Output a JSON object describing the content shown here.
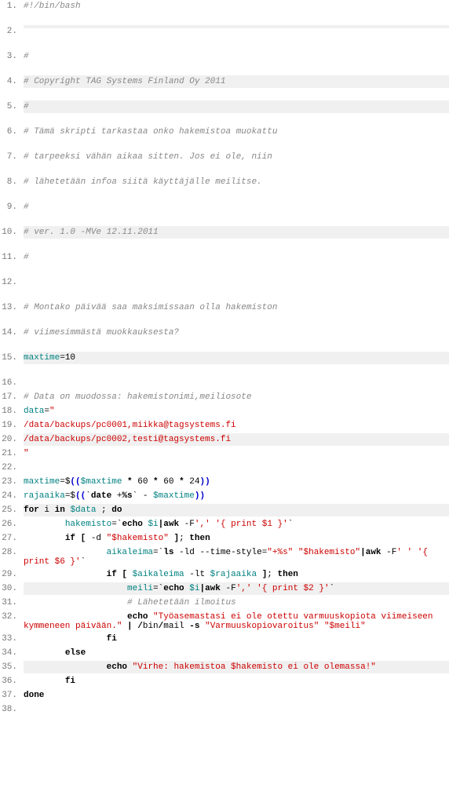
{
  "lines": [
    {
      "n": "1.",
      "tall": true,
      "hl": false,
      "spans": [
        {
          "t": "#!/bin/bash",
          "cls": "c-comment"
        }
      ]
    },
    {
      "n": "2.",
      "tall": true,
      "hl": true,
      "spans": []
    },
    {
      "n": "3.",
      "tall": true,
      "hl": false,
      "spans": [
        {
          "t": "#",
          "cls": "c-comment"
        }
      ]
    },
    {
      "n": "4.",
      "tall": true,
      "hl": true,
      "spans": [
        {
          "t": "# Copyright TAG Systems Finland Oy 2011",
          "cls": "c-comment"
        }
      ]
    },
    {
      "n": "5.",
      "tall": true,
      "hl": true,
      "spans": [
        {
          "t": "#",
          "cls": "c-comment"
        }
      ]
    },
    {
      "n": "6.",
      "tall": true,
      "hl": false,
      "spans": [
        {
          "t": "# Tämä skripti tarkastaa onko hakemistoa muokattu",
          "cls": "c-comment"
        }
      ]
    },
    {
      "n": "7.",
      "tall": true,
      "hl": false,
      "spans": [
        {
          "t": "# tarpeeksi vähän aikaa sitten. Jos ei ole, niin",
          "cls": "c-comment"
        }
      ]
    },
    {
      "n": "8.",
      "tall": true,
      "hl": false,
      "spans": [
        {
          "t": "# lähetetään infoa siitä käyttäjälle meilitse.",
          "cls": "c-comment"
        }
      ]
    },
    {
      "n": "9.",
      "tall": true,
      "hl": false,
      "spans": [
        {
          "t": "#",
          "cls": "c-comment"
        }
      ]
    },
    {
      "n": "10.",
      "tall": true,
      "hl": true,
      "spans": [
        {
          "t": "# ver. 1.0 -MVe 12.11.2011",
          "cls": "c-comment"
        }
      ]
    },
    {
      "n": "11.",
      "tall": true,
      "hl": false,
      "spans": [
        {
          "t": "#",
          "cls": "c-comment"
        }
      ]
    },
    {
      "n": "12.",
      "tall": true,
      "hl": false,
      "spans": []
    },
    {
      "n": "13.",
      "tall": true,
      "hl": false,
      "spans": [
        {
          "t": "# Montako päivää saa maksimissaan olla hakemiston",
          "cls": "c-comment"
        }
      ]
    },
    {
      "n": "14.",
      "tall": true,
      "hl": false,
      "spans": [
        {
          "t": "# viimesimmästä muokkauksesta?",
          "cls": "c-comment"
        }
      ]
    },
    {
      "n": "15.",
      "tall": true,
      "hl": true,
      "spans": [
        {
          "t": "maxtime",
          "cls": "c-var"
        },
        {
          "t": "=",
          "cls": ""
        },
        {
          "t": "10",
          "cls": "c-num"
        }
      ]
    },
    {
      "n": "16.",
      "hl": false,
      "spans": []
    },
    {
      "n": "17.",
      "hl": false,
      "spans": [
        {
          "t": "# Data on muodossa: hakemistonimi,meiliosote",
          "cls": "c-comment"
        }
      ]
    },
    {
      "n": "18.",
      "hl": false,
      "spans": [
        {
          "t": "data",
          "cls": "c-var"
        },
        {
          "t": "=",
          "cls": ""
        },
        {
          "t": "\"",
          "cls": "c-str"
        }
      ]
    },
    {
      "n": "19.",
      "hl": false,
      "spans": [
        {
          "t": "/data/backups/pc0001,miikka@tagsystems.fi",
          "cls": "c-str"
        }
      ]
    },
    {
      "n": "20.",
      "hl": true,
      "spans": [
        {
          "t": "/data/backups/pc0002,testi@tagsystems.fi",
          "cls": "c-str"
        }
      ]
    },
    {
      "n": "21.",
      "hl": false,
      "spans": [
        {
          "t": "\"",
          "cls": "c-str"
        }
      ]
    },
    {
      "n": "22.",
      "hl": false,
      "spans": []
    },
    {
      "n": "23.",
      "hl": false,
      "spans": [
        {
          "t": "maxtime",
          "cls": "c-var"
        },
        {
          "t": "=$",
          "cls": ""
        },
        {
          "t": "((",
          "cls": "c-paren"
        },
        {
          "t": "$maxtime",
          "cls": "c-var"
        },
        {
          "t": " * ",
          "cls": "c-kw"
        },
        {
          "t": "60",
          "cls": "c-num"
        },
        {
          "t": " * ",
          "cls": "c-kw"
        },
        {
          "t": "60",
          "cls": "c-num"
        },
        {
          "t": " * ",
          "cls": "c-kw"
        },
        {
          "t": "24",
          "cls": "c-num"
        },
        {
          "t": "))",
          "cls": "c-paren"
        }
      ]
    },
    {
      "n": "24.",
      "hl": false,
      "spans": [
        {
          "t": "rajaaika",
          "cls": "c-var"
        },
        {
          "t": "=$",
          "cls": ""
        },
        {
          "t": "((",
          "cls": "c-paren"
        },
        {
          "t": "`",
          "cls": "c-bt"
        },
        {
          "t": "date",
          "cls": "c-cmd"
        },
        {
          "t": " +",
          "cls": ""
        },
        {
          "t": "%s",
          "cls": "c-kw"
        },
        {
          "t": "` - ",
          "cls": ""
        },
        {
          "t": "$maxtime",
          "cls": "c-var"
        },
        {
          "t": "))",
          "cls": "c-paren"
        }
      ]
    },
    {
      "n": "25.",
      "hl": true,
      "spans": [
        {
          "t": "for",
          "cls": "c-kw"
        },
        {
          "t": " i ",
          "cls": ""
        },
        {
          "t": "in",
          "cls": "c-kw"
        },
        {
          "t": " ",
          "cls": ""
        },
        {
          "t": "$data",
          "cls": "c-var"
        },
        {
          "t": " ; ",
          "cls": ""
        },
        {
          "t": "do",
          "cls": "c-kw"
        }
      ]
    },
    {
      "n": "26.",
      "hl": false,
      "spans": [
        {
          "t": "        ",
          "cls": ""
        },
        {
          "t": "hakemisto",
          "cls": "c-var"
        },
        {
          "t": "=`",
          "cls": ""
        },
        {
          "t": "echo",
          "cls": "c-echo"
        },
        {
          "t": " ",
          "cls": ""
        },
        {
          "t": "$i",
          "cls": "c-var"
        },
        {
          "t": "|",
          "cls": "c-pipe"
        },
        {
          "t": "awk",
          "cls": "c-cmd"
        },
        {
          "t": " -F",
          "cls": ""
        },
        {
          "t": "','",
          "cls": "c-str"
        },
        {
          "t": " ",
          "cls": ""
        },
        {
          "t": "'{ print $1 }'",
          "cls": "c-str"
        },
        {
          "t": "`",
          "cls": ""
        }
      ]
    },
    {
      "n": "27.",
      "hl": false,
      "spans": [
        {
          "t": "        ",
          "cls": ""
        },
        {
          "t": "if",
          "cls": "c-kw"
        },
        {
          "t": " [ ",
          "cls": "c-kw"
        },
        {
          "t": "-d ",
          "cls": ""
        },
        {
          "t": "\"$hakemisto\"",
          "cls": "c-str"
        },
        {
          "t": " ]",
          "cls": "c-kw"
        },
        {
          "t": "; ",
          "cls": ""
        },
        {
          "t": "then",
          "cls": "c-kw"
        }
      ]
    },
    {
      "n": "28.",
      "hl": false,
      "spans": [
        {
          "t": "                ",
          "cls": ""
        },
        {
          "t": "aikaleima",
          "cls": "c-var"
        },
        {
          "t": "=`",
          "cls": ""
        },
        {
          "t": "ls",
          "cls": "c-cmd"
        },
        {
          "t": " -ld --time-style=",
          "cls": ""
        },
        {
          "t": "\"+%s\"",
          "cls": "c-str"
        },
        {
          "t": " ",
          "cls": ""
        },
        {
          "t": "\"$hakemisto\"",
          "cls": "c-str"
        },
        {
          "t": "|",
          "cls": "c-pipe"
        },
        {
          "t": "awk",
          "cls": "c-cmd"
        },
        {
          "t": " -F",
          "cls": ""
        },
        {
          "t": "' '",
          "cls": "c-str"
        },
        {
          "t": " ",
          "cls": ""
        },
        {
          "t": "'{ print $6 }'",
          "cls": "c-str"
        },
        {
          "t": "`",
          "cls": ""
        }
      ]
    },
    {
      "n": "29.",
      "hl": false,
      "spans": [
        {
          "t": "                ",
          "cls": ""
        },
        {
          "t": "if",
          "cls": "c-kw"
        },
        {
          "t": " [ ",
          "cls": "c-kw"
        },
        {
          "t": "$aikaleima",
          "cls": "c-var"
        },
        {
          "t": " -lt ",
          "cls": ""
        },
        {
          "t": "$rajaaika",
          "cls": "c-var"
        },
        {
          "t": " ]",
          "cls": "c-kw"
        },
        {
          "t": "; ",
          "cls": ""
        },
        {
          "t": "then",
          "cls": "c-kw"
        }
      ]
    },
    {
      "n": "30.",
      "hl": true,
      "spans": [
        {
          "t": "                    ",
          "cls": ""
        },
        {
          "t": "meili",
          "cls": "c-var"
        },
        {
          "t": "=`",
          "cls": ""
        },
        {
          "t": "echo",
          "cls": "c-echo"
        },
        {
          "t": " ",
          "cls": ""
        },
        {
          "t": "$i",
          "cls": "c-var"
        },
        {
          "t": "|",
          "cls": "c-pipe"
        },
        {
          "t": "awk",
          "cls": "c-cmd"
        },
        {
          "t": " -F",
          "cls": ""
        },
        {
          "t": "','",
          "cls": "c-str"
        },
        {
          "t": " ",
          "cls": ""
        },
        {
          "t": "'{ print $2 }'",
          "cls": "c-str"
        },
        {
          "t": "`",
          "cls": ""
        }
      ]
    },
    {
      "n": "31.",
      "hl": false,
      "spans": [
        {
          "t": "                    ",
          "cls": ""
        },
        {
          "t": "# Lähetetään ilmoitus",
          "cls": "c-comment"
        }
      ]
    },
    {
      "n": "32.",
      "hl": false,
      "spans": [
        {
          "t": "                    ",
          "cls": ""
        },
        {
          "t": "echo",
          "cls": "c-echo"
        },
        {
          "t": " ",
          "cls": ""
        },
        {
          "t": "\"Työasemastasi ei ole otettu varmuuskopiota viimeiseen kymmeneen päivään.\"",
          "cls": "c-str"
        },
        {
          "t": " | ",
          "cls": "c-pipe"
        },
        {
          "t": "/",
          "cls": "c-kw"
        },
        {
          "t": "bin",
          "cls": ""
        },
        {
          "t": "/",
          "cls": "c-kw"
        },
        {
          "t": "mail ",
          "cls": ""
        },
        {
          "t": "-s",
          "cls": "c-kw"
        },
        {
          "t": " ",
          "cls": ""
        },
        {
          "t": "\"Varmuuskopiovaroitus\"",
          "cls": "c-str"
        },
        {
          "t": " ",
          "cls": ""
        },
        {
          "t": "\"$meili\"",
          "cls": "c-str"
        }
      ]
    },
    {
      "n": "33.",
      "hl": false,
      "spans": [
        {
          "t": "                ",
          "cls": ""
        },
        {
          "t": "fi",
          "cls": "c-kw"
        }
      ]
    },
    {
      "n": "34.",
      "hl": false,
      "spans": [
        {
          "t": "        ",
          "cls": ""
        },
        {
          "t": "else",
          "cls": "c-kw"
        }
      ]
    },
    {
      "n": "35.",
      "hl": true,
      "spans": [
        {
          "t": "                ",
          "cls": ""
        },
        {
          "t": "echo",
          "cls": "c-echo"
        },
        {
          "t": " ",
          "cls": ""
        },
        {
          "t": "\"Virhe: hakemistoa $hakemisto ei ole olemassa!\"",
          "cls": "c-str"
        }
      ]
    },
    {
      "n": "36.",
      "hl": false,
      "spans": [
        {
          "t": "        ",
          "cls": ""
        },
        {
          "t": "fi",
          "cls": "c-kw"
        }
      ]
    },
    {
      "n": "37.",
      "hl": false,
      "spans": [
        {
          "t": "done",
          "cls": "c-kw"
        }
      ]
    },
    {
      "n": "38.",
      "hl": false,
      "spans": []
    }
  ]
}
